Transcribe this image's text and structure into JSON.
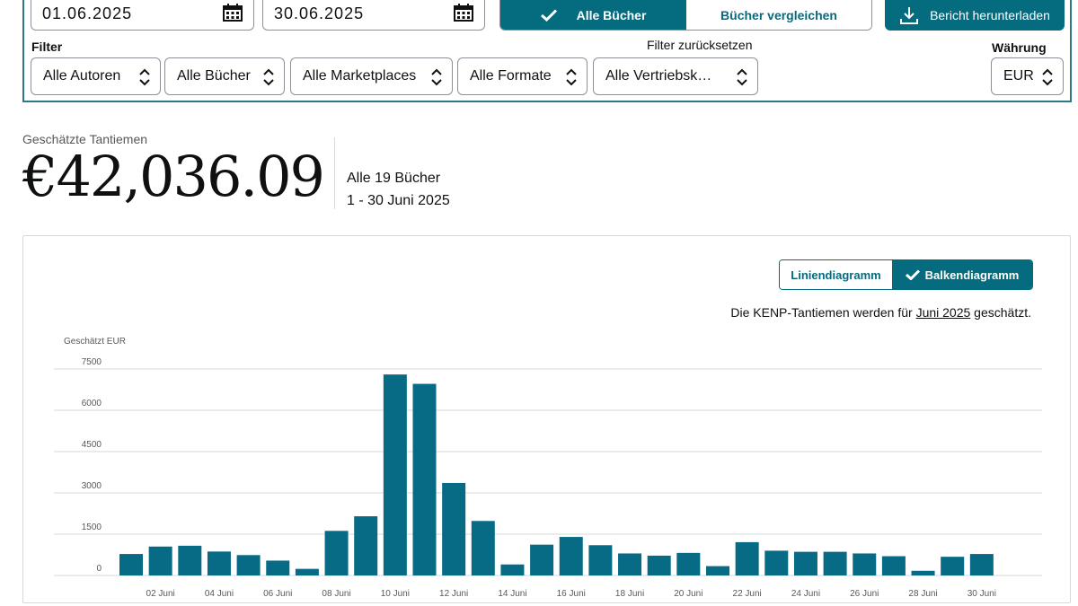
{
  "dates": {
    "start": "01.06.2025",
    "end": "30.06.2025"
  },
  "book_toggle": {
    "all_books": "Alle Bücher",
    "compare": "Bücher vergleichen"
  },
  "download": {
    "label": "Bericht herunterladen"
  },
  "filter": {
    "title": "Filter",
    "reset": "Filter zurücksetzen",
    "authors": "Alle Autoren",
    "books": "Alle Bücher",
    "marketplaces": "Alle Marketplaces",
    "formats": "Alle Formate",
    "channels": "Alle Vertriebsk…"
  },
  "currency": {
    "label": "Währung",
    "value": "EUR"
  },
  "summary": {
    "label": "Geschätzte Tantiemen",
    "amount": "€42,036.09",
    "books_count": "Alle 19 Bücher",
    "period": "1 - 30 Juni 2025"
  },
  "chart_toggle": {
    "line": "Liniendiagramm",
    "bar": "Balkendiagramm"
  },
  "kenp_note": {
    "prefix": "Die KENP-Tantiemen werden für ",
    "link": "Juni 2025",
    "suffix": " geschätzt."
  },
  "colors": {
    "accent": "#056b7f",
    "bar": "#076b85",
    "grid": "#d5d9d9"
  },
  "chart_data": {
    "type": "bar",
    "ylabel": "Geschätzt EUR",
    "yticks": [
      0,
      1500,
      3000,
      4500,
      6000,
      7500
    ],
    "ylim": [
      0,
      7500
    ],
    "categories": [
      "01 Juni",
      "02 Juni",
      "03 Juni",
      "04 Juni",
      "05 Juni",
      "06 Juni",
      "07 Juni",
      "08 Juni",
      "09 Juni",
      "10 Juni",
      "11 Juni",
      "12 Juni",
      "13 Juni",
      "14 Juni",
      "15 Juni",
      "16 Juni",
      "17 Juni",
      "18 Juni",
      "19 Juni",
      "20 Juni",
      "21 Juni",
      "22 Juni",
      "23 Juni",
      "24 Juni",
      "25 Juni",
      "26 Juni",
      "27 Juni",
      "28 Juni",
      "29 Juni",
      "30 Juni"
    ],
    "x_tick_labels": [
      "02 Juni",
      "04 Juni",
      "06 Juni",
      "08 Juni",
      "10 Juni",
      "12 Juni",
      "14 Juni",
      "16 Juni",
      "18 Juni",
      "20 Juni",
      "22 Juni",
      "24 Juni",
      "26 Juni",
      "28 Juni",
      "30 Juni"
    ],
    "values": [
      780,
      1050,
      1080,
      870,
      740,
      540,
      240,
      1620,
      2150,
      7300,
      6960,
      3360,
      1980,
      400,
      1120,
      1400,
      1100,
      800,
      720,
      820,
      340,
      1210,
      900,
      860,
      860,
      800,
      700,
      170,
      680,
      780
    ],
    "grid": true
  }
}
